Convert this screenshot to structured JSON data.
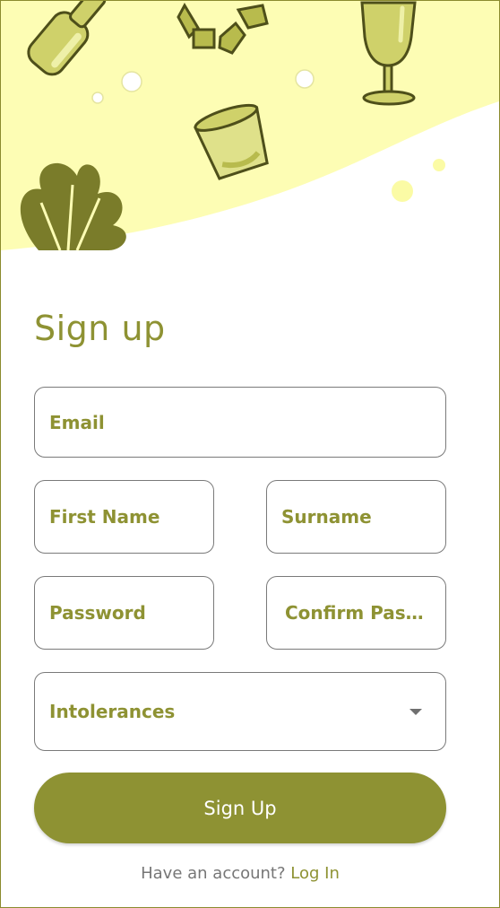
{
  "page": {
    "title": "Sign up"
  },
  "colors": {
    "accent": "#8e9233",
    "hero_bg": "#fdfdb4",
    "illustration": "#b8bb4d",
    "leaf": "#7a7c2a",
    "border": "#7a7a7a"
  },
  "illustration_icons": [
    "bottle-icon",
    "recycle-icon",
    "wine-glass-icon",
    "cup-icon",
    "leaf-icon"
  ],
  "form": {
    "email_placeholder": "Email",
    "first_name_placeholder": "First Name",
    "surname_placeholder": "Surname",
    "password_placeholder": "Password",
    "confirm_password_placeholder": "Confirm Pass...",
    "intolerances_label": "Intolerances",
    "submit_label": "Sign Up"
  },
  "footer": {
    "prompt": "Have an account?",
    "link": "Log In"
  }
}
